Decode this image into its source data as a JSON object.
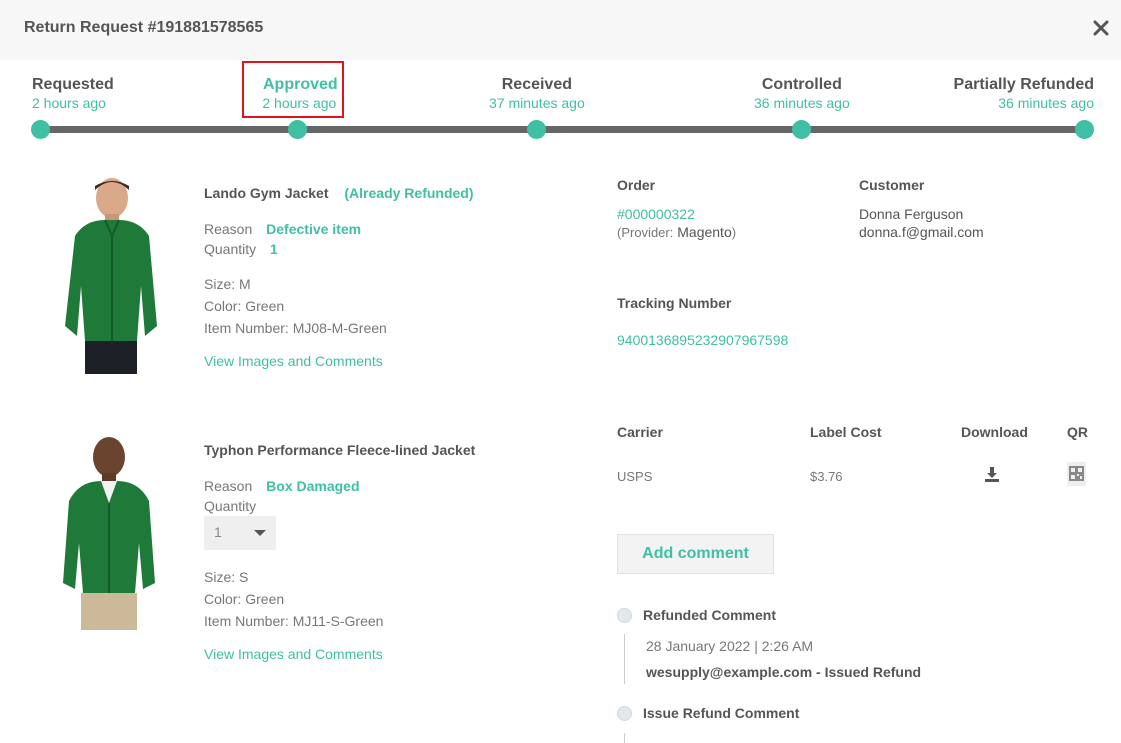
{
  "header": {
    "title": "Return Request #191881578565"
  },
  "timeline": [
    {
      "label": "Requested",
      "time": "2 hours ago"
    },
    {
      "label": "Approved",
      "time": "2 hours ago"
    },
    {
      "label": "Received",
      "time": "37 minutes ago"
    },
    {
      "label": "Controlled",
      "time": "36 minutes ago"
    },
    {
      "label": "Partially Refunded",
      "time": "36 minutes ago"
    }
  ],
  "products": [
    {
      "name": "Lando Gym Jacket",
      "tag": "(Already Refunded)",
      "reason_label": "Reason",
      "reason": "Defective item",
      "quantity_label": "Quantity",
      "quantity": "1",
      "size": "Size: M",
      "color": "Color: Green",
      "item_number": "Item Number: MJ08-M-Green",
      "link": "View Images and Comments"
    },
    {
      "name": "Typhon Performance Fleece-lined Jacket",
      "reason_label": "Reason",
      "reason": "Box Damaged",
      "quantity_label": "Quantity",
      "quantity": "1",
      "size": "Size: S",
      "color": "Color: Green",
      "item_number": "Item Number: MJ11-S-Green",
      "link": "View Images and Comments"
    }
  ],
  "order": {
    "label": "Order",
    "number": "#000000322",
    "provider_prefix": "(Provider:",
    "provider": "Magento",
    "provider_suffix": ")"
  },
  "customer": {
    "label": "Customer",
    "name": "Donna Ferguson",
    "email": "donna.f@gmail.com"
  },
  "tracking": {
    "label": "Tracking Number",
    "number": "9400136895232907967598"
  },
  "label_table": {
    "headers": [
      "Carrier",
      "Label Cost",
      "Download",
      "QR"
    ],
    "carrier": "USPS",
    "cost": "$3.76"
  },
  "add_comment": "Add comment",
  "comments": [
    {
      "title": "Refunded Comment",
      "date": "28 January 2022 | 2:26 AM",
      "body": "wesupply@example.com - Issued Refund"
    },
    {
      "title": "Issue Refund Comment"
    }
  ],
  "colors": {
    "accent": "#3fbfa4",
    "track": "#666666",
    "highlight": "#e0141e"
  }
}
